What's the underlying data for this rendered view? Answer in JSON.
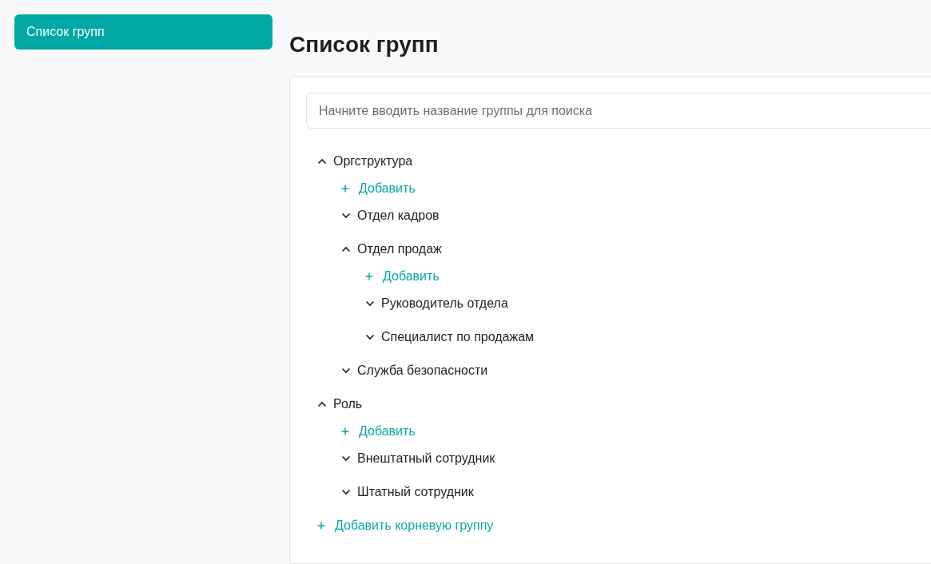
{
  "sidebar": {
    "items": [
      {
        "label": "Список групп",
        "selected": true
      }
    ]
  },
  "page_title": "Список групп",
  "search": {
    "placeholder": "Начните вводить название группы для поиска"
  },
  "tree": [
    {
      "kind": "group",
      "label": "Оргструктура",
      "expanded": true,
      "children": [
        {
          "kind": "add",
          "label": "Добавить"
        },
        {
          "kind": "group",
          "label": "Отдел кадров",
          "expanded": false
        },
        {
          "kind": "group",
          "label": "Отдел продаж",
          "expanded": true,
          "children": [
            {
              "kind": "add",
              "label": "Добавить"
            },
            {
              "kind": "group",
              "label": "Руководитель отдела",
              "expanded": false
            },
            {
              "kind": "group",
              "label": "Специалист по продажам",
              "expanded": false
            }
          ]
        },
        {
          "kind": "group",
          "label": "Служба безопасности",
          "expanded": false
        }
      ]
    },
    {
      "kind": "group",
      "label": "Роль",
      "expanded": true,
      "children": [
        {
          "kind": "add",
          "label": "Добавить"
        },
        {
          "kind": "group",
          "label": "Внештатный сотрудник",
          "expanded": false
        },
        {
          "kind": "group",
          "label": "Штатный сотрудник",
          "expanded": false
        }
      ]
    },
    {
      "kind": "add",
      "label": "Добавить корневую группу"
    }
  ]
}
